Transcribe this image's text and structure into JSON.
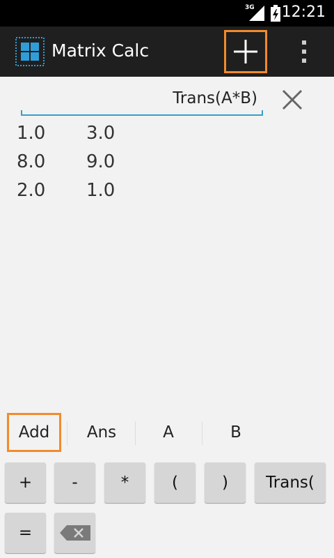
{
  "status_bar": {
    "network": "3G",
    "time": "12:21"
  },
  "action_bar": {
    "title": "Matrix Calc",
    "add_icon": "plus-icon",
    "overflow_icon": "overflow-menu-icon"
  },
  "expression": {
    "value": "Trans(A*B)"
  },
  "result_matrix": [
    [
      "1.0",
      "3.0"
    ],
    [
      "8.0",
      "9.0"
    ],
    [
      "2.0",
      "1.0"
    ]
  ],
  "suggestions": [
    "Add",
    "Ans",
    "A",
    "B"
  ],
  "keypad": {
    "row1": [
      "+",
      "-",
      "*",
      "(",
      ")",
      "Trans("
    ],
    "row2": [
      "="
    ],
    "backspace_icon": "backspace-icon"
  },
  "colors": {
    "highlight": "#f28b2c",
    "accent": "#36a0c8",
    "action_bar": "#1f1f1f"
  }
}
